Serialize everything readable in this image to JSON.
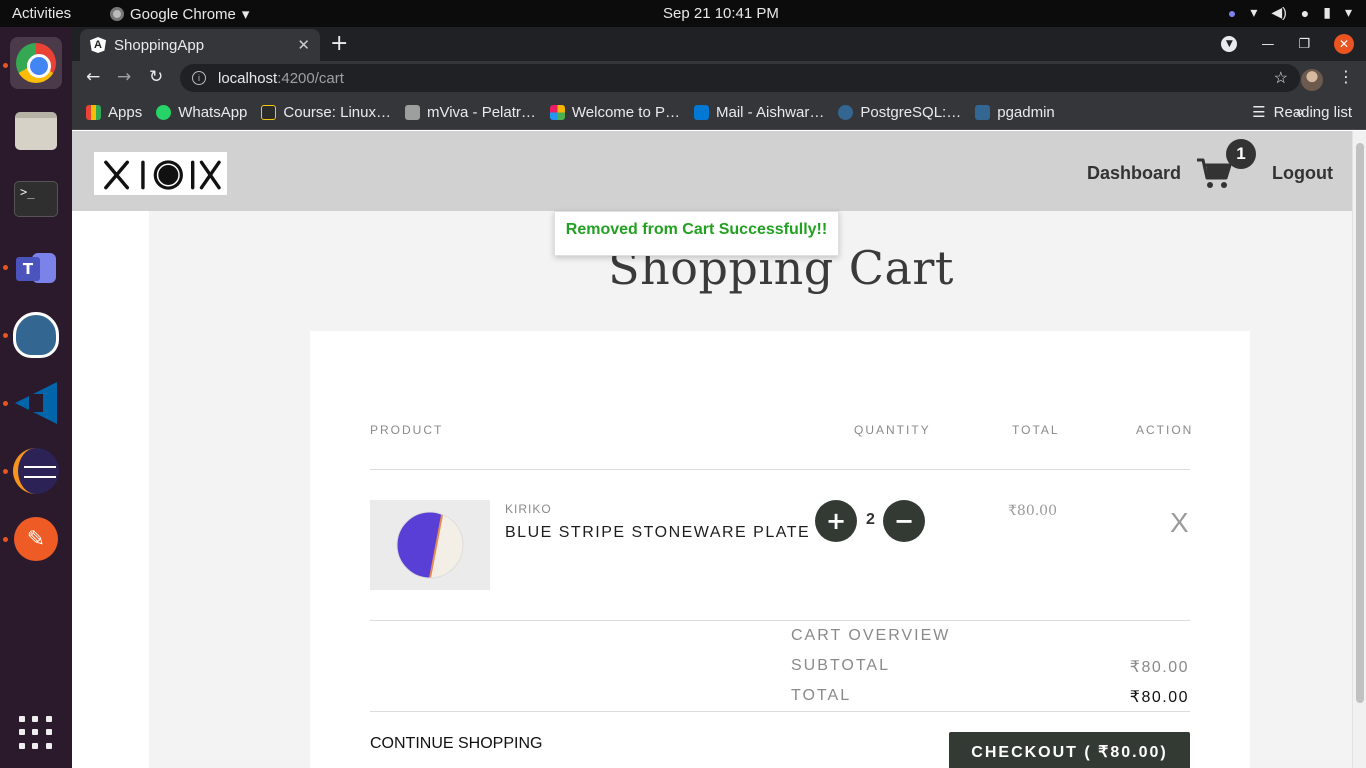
{
  "os": {
    "activities": "Activities",
    "app_menu": "Google Chrome",
    "clock": "Sep 21  10:41 PM"
  },
  "browser": {
    "tab_title": "ShoppingApp",
    "url_host": "localhost",
    "url_path": ":4200/cart",
    "bookmarks": [
      {
        "label": "Apps",
        "icon": "apps-grid-icon",
        "color": "#ea4335"
      },
      {
        "label": "WhatsApp",
        "icon": "whatsapp-icon",
        "color": "#25d366"
      },
      {
        "label": "Course: Linux…",
        "icon": "course-icon",
        "color": "#f2c811"
      },
      {
        "label": "mViva - Pelatr…",
        "icon": "mviva-icon",
        "color": "#9e9e9e"
      },
      {
        "label": "Welcome to P…",
        "icon": "pinwheel-icon",
        "color": "#f4b400"
      },
      {
        "label": "Mail - Aishwar…",
        "icon": "outlook-icon",
        "color": "#0078d4"
      },
      {
        "label": "PostgreSQL:…",
        "icon": "postgres-icon",
        "color": "#336791"
      },
      {
        "label": "pgadmin",
        "icon": "pgadmin-icon",
        "color": "#336791"
      }
    ],
    "more": "»",
    "reading_list": "Reading list"
  },
  "app": {
    "nav": {
      "dashboard": "Dashboard",
      "logout": "Logout",
      "cart_count": "1"
    },
    "toast": "Removed from Cart Successfully!!",
    "page_title": "Shopping Cart",
    "table": {
      "headers": {
        "product": "PRODUCT",
        "quantity": "QUANTITY",
        "total": "TOTAL",
        "action": "ACTION"
      }
    },
    "items": [
      {
        "brand": "KIRIKO",
        "name": "BLUE STRIPE STONEWARE PLATE",
        "quantity": "2",
        "total": "₹80.00",
        "remove": "X"
      }
    ],
    "overview": {
      "title": "CART OVERVIEW",
      "subtotal_label": "SUBTOTAL",
      "subtotal": "₹80.00",
      "total_label": "TOTAL",
      "total": "₹80.00"
    },
    "continue": "CONTINUE SHOPPING",
    "checkout": "CHECKOUT ( ₹80.00)"
  },
  "colors": {
    "accent_dark": "#333a33",
    "toast_green": "#22a022",
    "header_bg": "#d1d1d1"
  }
}
